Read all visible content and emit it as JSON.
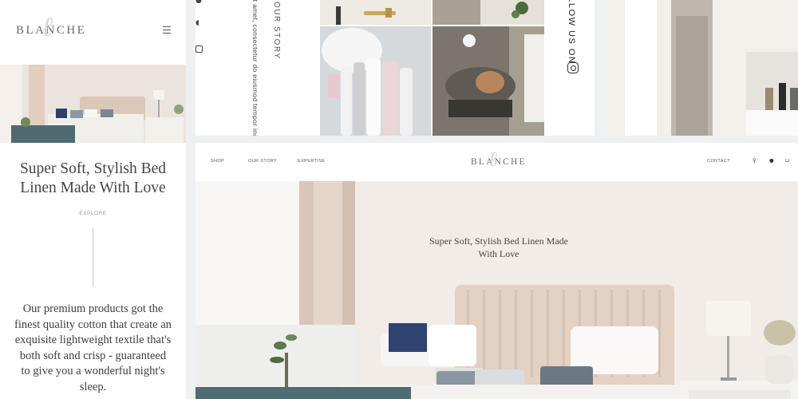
{
  "mobile": {
    "logo": "BLANCHE",
    "hero_title": "Super Soft, Stylish Bed Linen Made With Love",
    "explore": "EXPLORE",
    "description": "Our premium products got the finest quality cotton that create an exquisite lightweight textile that's both soft and crisp - guaranteed to give you a wonderful night's sleep."
  },
  "story_panel": {
    "lorem_text": "dolor sit amet, consectetur do eiusmod tempor incididunt dolore magna aliqua.",
    "our_story": "OUR STORY",
    "follow_us": "FOLLOW US ON"
  },
  "desktop": {
    "nav": {
      "shop": "SHOP",
      "our_story": "OUR STORY",
      "expertise": "EXPERTISE",
      "contact": "CONTACT"
    },
    "logo": "BLANCHE",
    "hero_title": "Super Soft, Stylish Bed Linen Made With Love"
  },
  "icons": [
    "apple-icon",
    "instagram-icon",
    "menu-icon",
    "search-icon",
    "user-icon",
    "cart-icon"
  ],
  "colors": {
    "background": "#eef0f1",
    "panel": "#ffffff",
    "text": "#3b3b3b",
    "muted": "#9a9a9a"
  }
}
